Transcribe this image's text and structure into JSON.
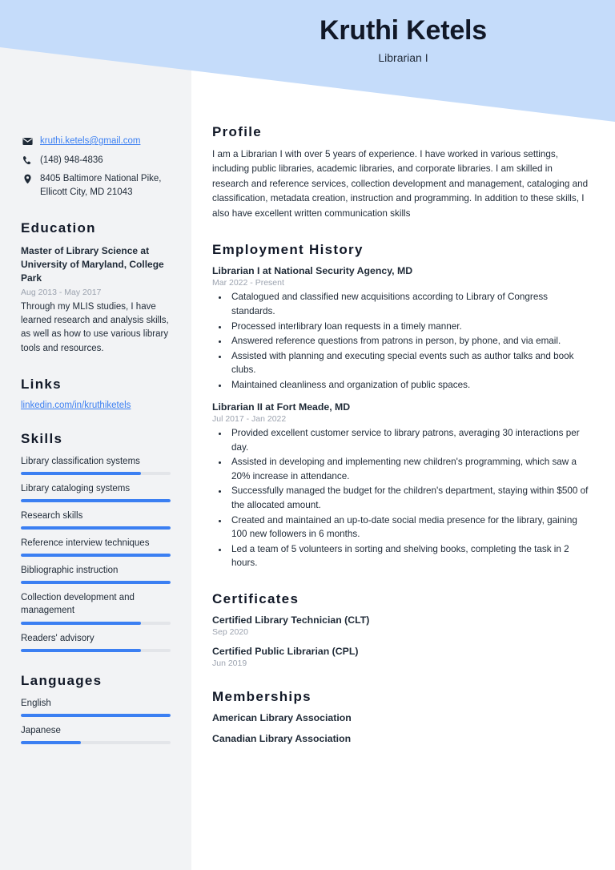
{
  "theme": {
    "banner_blue": "#c5dcfa",
    "sidebar_gray": "#f2f3f5",
    "accent_blue": "#3b7ff2",
    "text_dark": "#1f2a37",
    "muted_gray": "#9ca3af"
  },
  "header": {
    "name": "Kruthi Ketels",
    "job_title": "Librarian I"
  },
  "sidebar": {
    "contact": [
      {
        "icon": "envelope-icon",
        "text": "kruthi.ketels@gmail.com",
        "is_link": true
      },
      {
        "icon": "phone-icon",
        "text": "(148) 948-4836",
        "is_link": false
      },
      {
        "icon": "location-pin-icon",
        "text": "8405 Baltimore National Pike, Ellicott City, MD 21043",
        "is_link": false
      }
    ],
    "education": {
      "heading": "Education",
      "entries": [
        {
          "title": "Master of Library Science at University of Maryland, College Park",
          "date": "Aug 2013 - May 2017",
          "description": "Through my MLIS studies, I have learned research and analysis skills, as well as how to use various library tools and resources."
        }
      ]
    },
    "links": {
      "heading": "Links",
      "items": [
        {
          "label": "linkedin.com/in/kruthiketels"
        }
      ]
    },
    "skills": {
      "heading": "Skills",
      "items": [
        {
          "label": "Library classification systems",
          "level": 80
        },
        {
          "label": "Library cataloging systems",
          "level": 100
        },
        {
          "label": "Research skills",
          "level": 100
        },
        {
          "label": "Reference interview techniques",
          "level": 100
        },
        {
          "label": "Bibliographic instruction",
          "level": 100
        },
        {
          "label": "Collection development and management",
          "level": 80
        },
        {
          "label": "Readers' advisory",
          "level": 80
        }
      ]
    },
    "languages": {
      "heading": "Languages",
      "items": [
        {
          "label": "English",
          "level": 100
        },
        {
          "label": "Japanese",
          "level": 40
        }
      ]
    }
  },
  "main": {
    "profile": {
      "heading": "Profile",
      "text": "I am a Librarian I with over 5 years of experience. I have worked in various settings, including public libraries, academic libraries, and corporate libraries. I am skilled in research and reference services, collection development and management, cataloging and classification, metadata creation, instruction and programming. In addition to these skills, I also have excellent written communication skills"
    },
    "employment": {
      "heading": "Employment History",
      "jobs": [
        {
          "title": "Librarian I at National Security Agency, MD",
          "date": "Mar 2022 - Present",
          "bullets": [
            "Catalogued and classified new acquisitions according to Library of Congress standards.",
            "Processed interlibrary loan requests in a timely manner.",
            "Answered reference questions from patrons in person, by phone, and via email.",
            "Assisted with planning and executing special events such as author talks and book clubs.",
            "Maintained cleanliness and organization of public spaces."
          ]
        },
        {
          "title": "Librarian II at Fort Meade, MD",
          "date": "Jul 2017 - Jan 2022",
          "bullets": [
            "Provided excellent customer service to library patrons, averaging 30 interactions per day.",
            "Assisted in developing and implementing new children's programming, which saw a 20% increase in attendance.",
            "Successfully managed the budget for the children's department, staying within $500 of the allocated amount.",
            "Created and maintained an up-to-date social media presence for the library, gaining 100 new followers in 6 months.",
            "Led a team of 5 volunteers in sorting and shelving books, completing the task in 2 hours."
          ]
        }
      ]
    },
    "certificates": {
      "heading": "Certificates",
      "items": [
        {
          "name": "Certified Library Technician (CLT)",
          "date": "Sep 2020"
        },
        {
          "name": "Certified Public Librarian (CPL)",
          "date": "Jun 2019"
        }
      ]
    },
    "memberships": {
      "heading": "Memberships",
      "items": [
        {
          "name": "American Library Association"
        },
        {
          "name": "Canadian Library Association"
        }
      ]
    }
  }
}
